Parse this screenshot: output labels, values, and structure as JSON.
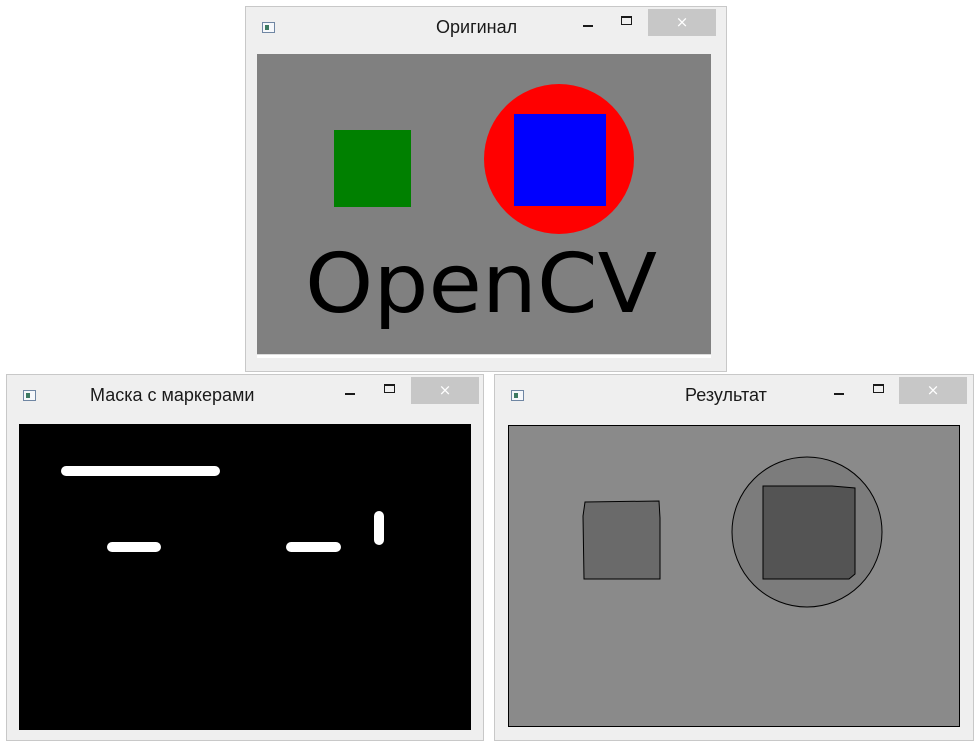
{
  "windows": {
    "original": {
      "title": "Оригинал",
      "image_text": "OpenCV",
      "colors": {
        "background": "#808080",
        "green_square": "#008000",
        "red_circle": "#ff0000",
        "blue_square": "#0000ff",
        "text": "#000000"
      }
    },
    "mask": {
      "title": "Маска с маркерами",
      "colors": {
        "background": "#000000",
        "marker": "#ffffff"
      }
    },
    "result": {
      "title": "Результат",
      "colors": {
        "background": "#8a8a8a",
        "left_region": "#6a6a6a",
        "circle_region": "#7c7c7c",
        "inner_square": "#545454",
        "boundary": "#000000"
      }
    }
  },
  "controls": {
    "minimize_glyph": "",
    "maximize_glyph": "",
    "close_glyph": "×"
  }
}
